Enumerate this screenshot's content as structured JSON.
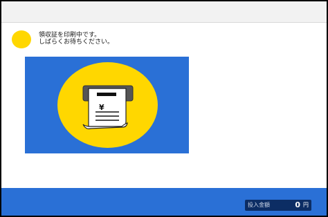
{
  "message": {
    "line1": "領収証を印刷中です。",
    "line2": "しばらくお待ちください。"
  },
  "illustration": {
    "icon": "receipt-printer-icon",
    "currency_symbol": "¥"
  },
  "footer": {
    "amount_label": "投入金額",
    "amount_value": "0",
    "amount_unit": "円"
  },
  "colors": {
    "accent_blue": "#2a70d6",
    "status_yellow": "#ffd700",
    "amount_box": "#0c2d64"
  }
}
